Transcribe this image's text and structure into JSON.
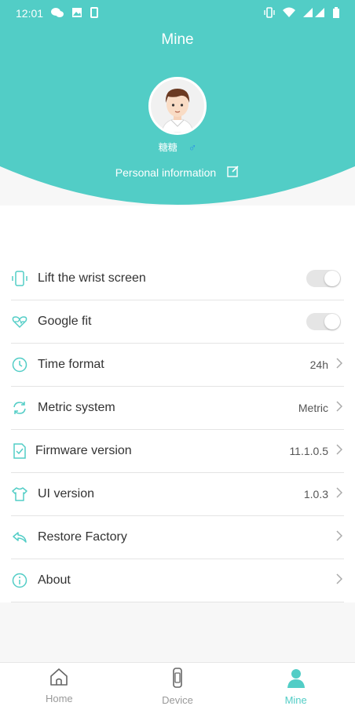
{
  "status_bar": {
    "time": "12:01",
    "left_icons": [
      "wechat-icon",
      "image-icon",
      "sim-icon"
    ],
    "right_icons": [
      "vibrate-icon",
      "wifi-icon",
      "signal-icon",
      "battery-icon"
    ]
  },
  "header": {
    "title": "Mine",
    "username": "糖糖",
    "gender_symbol": "♂",
    "personal_info_label": "Personal information"
  },
  "settings": [
    {
      "label": "Lift the wrist screen",
      "type": "toggle",
      "on": false,
      "icon": "wrist-icon"
    },
    {
      "label": "Google fit",
      "type": "toggle",
      "on": false,
      "icon": "heart-icon"
    },
    {
      "label": "Time format",
      "type": "value",
      "value": "24h",
      "icon": "clock-icon"
    },
    {
      "label": "Metric system",
      "type": "value",
      "value": "Metric",
      "icon": "refresh-icon"
    },
    {
      "label": "Firmware version",
      "type": "value",
      "value": "11.1.0.5",
      "icon": "firmware-icon"
    },
    {
      "label": "UI version",
      "type": "value",
      "value": "1.0.3",
      "icon": "shirt-icon"
    },
    {
      "label": "Restore Factory",
      "type": "link",
      "value": "",
      "icon": "restore-icon"
    },
    {
      "label": "About",
      "type": "link",
      "value": "",
      "icon": "info-icon"
    }
  ],
  "tabs": [
    {
      "label": "Home",
      "icon": "home-icon",
      "active": false
    },
    {
      "label": "Device",
      "icon": "watch-icon",
      "active": false
    },
    {
      "label": "Mine",
      "icon": "person-icon",
      "active": true
    }
  ],
  "colors": {
    "accent": "#52cdc6",
    "gender": "#2b8fe8"
  }
}
